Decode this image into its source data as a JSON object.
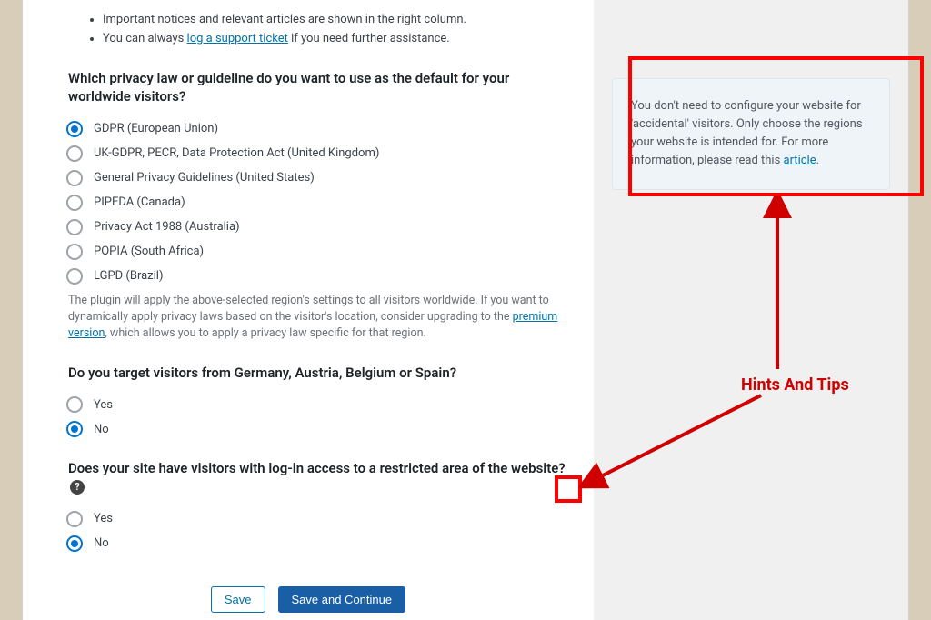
{
  "instructions": [
    {
      "text": "Important notices and relevant articles are shown in the right column."
    },
    {
      "prefix": "You can always ",
      "link": "log a support ticket",
      "suffix": " if you need further assistance."
    }
  ],
  "q1": {
    "title": "Which privacy law or guideline do you want to use as the default for your worldwide visitors?",
    "options": [
      {
        "label": "GDPR (European Union)",
        "checked": true
      },
      {
        "label": "UK-GDPR, PECR, Data Protection Act (United Kingdom)",
        "checked": false
      },
      {
        "label": "General Privacy Guidelines (United States)",
        "checked": false
      },
      {
        "label": "PIPEDA (Canada)",
        "checked": false
      },
      {
        "label": "Privacy Act 1988 (Australia)",
        "checked": false
      },
      {
        "label": "POPIA (South Africa)",
        "checked": false
      },
      {
        "label": "LGPD (Brazil)",
        "checked": false
      }
    ],
    "helper_prefix": "The plugin will apply the above-selected region's settings to all visitors worldwide. If you want to dynamically apply privacy laws based on the visitor's location, consider upgrading to the ",
    "helper_link": "premium version",
    "helper_suffix": ", which allows you to apply a privacy law specific for that region."
  },
  "q2": {
    "title": "Do you target visitors from Germany, Austria, Belgium or Spain?",
    "options": [
      {
        "label": "Yes",
        "checked": false
      },
      {
        "label": "No",
        "checked": true
      }
    ]
  },
  "q3": {
    "title": "Does your site have visitors with log-in access to a restricted area of the website?",
    "help_glyph": "?",
    "options": [
      {
        "label": "Yes",
        "checked": false
      },
      {
        "label": "No",
        "checked": true
      }
    ]
  },
  "buttons": {
    "save": "Save",
    "save_continue": "Save and Continue"
  },
  "tip": {
    "text_prefix": "You don't need to configure your website for 'accidental' visitors. Only choose the regions your website is intended for. For more information, please read this ",
    "link": "article",
    "suffix": "."
  },
  "annotation_label": "Hints And Tips"
}
